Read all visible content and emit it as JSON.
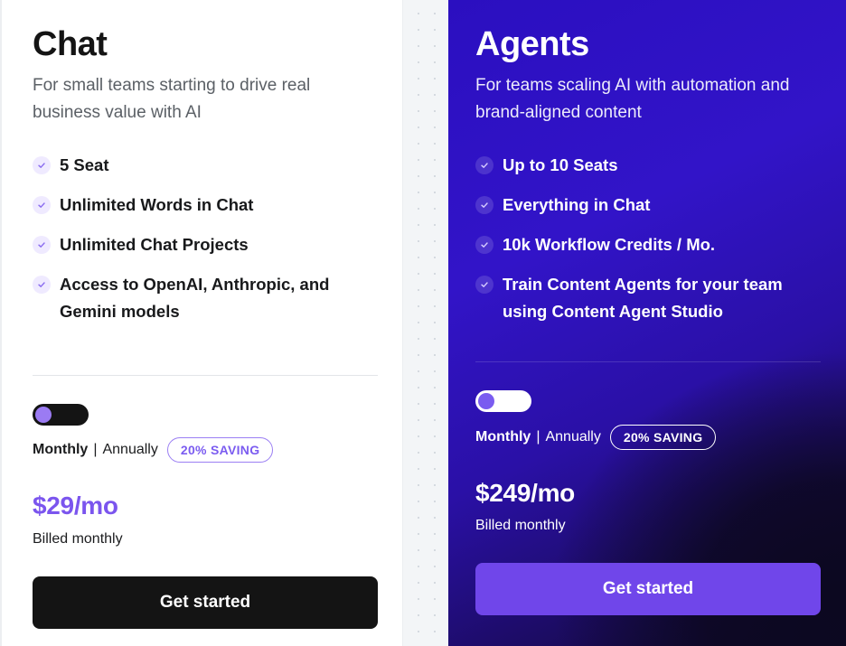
{
  "plans": [
    {
      "title": "Chat",
      "subtitle": "For small teams starting to drive real business value with AI",
      "features": [
        "5 Seat",
        "Unlimited Words in Chat",
        "Unlimited Chat Projects",
        "Access to OpenAI, Anthropic, and Gemini models"
      ],
      "billing": {
        "monthly": "Monthly",
        "separator": "|",
        "annually": "Annually",
        "saving_badge": "20% SAVING",
        "toggle_state": "monthly"
      },
      "price": "$29/mo",
      "billed": "Billed monthly",
      "cta": "Get started"
    },
    {
      "title": "Agents",
      "subtitle": "For teams scaling AI with automation and brand-aligned content",
      "features": [
        "Up to 10 Seats",
        "Everything in Chat",
        "10k Workflow Credits / Mo.",
        "Train Content Agents for your team using Content Agent Studio"
      ],
      "billing": {
        "monthly": "Monthly",
        "separator": "|",
        "annually": "Annually",
        "saving_badge": "20% SAVING",
        "toggle_state": "monthly"
      },
      "price": "$249/mo",
      "billed": "Billed monthly",
      "cta": "Get started"
    }
  ],
  "colors": {
    "accent_purple": "#7b55ee",
    "agents_button": "#7046ea",
    "agents_bg_top": "#3214c8",
    "chat_button": "#141414"
  },
  "icons": {
    "feature_check": "check-icon"
  }
}
